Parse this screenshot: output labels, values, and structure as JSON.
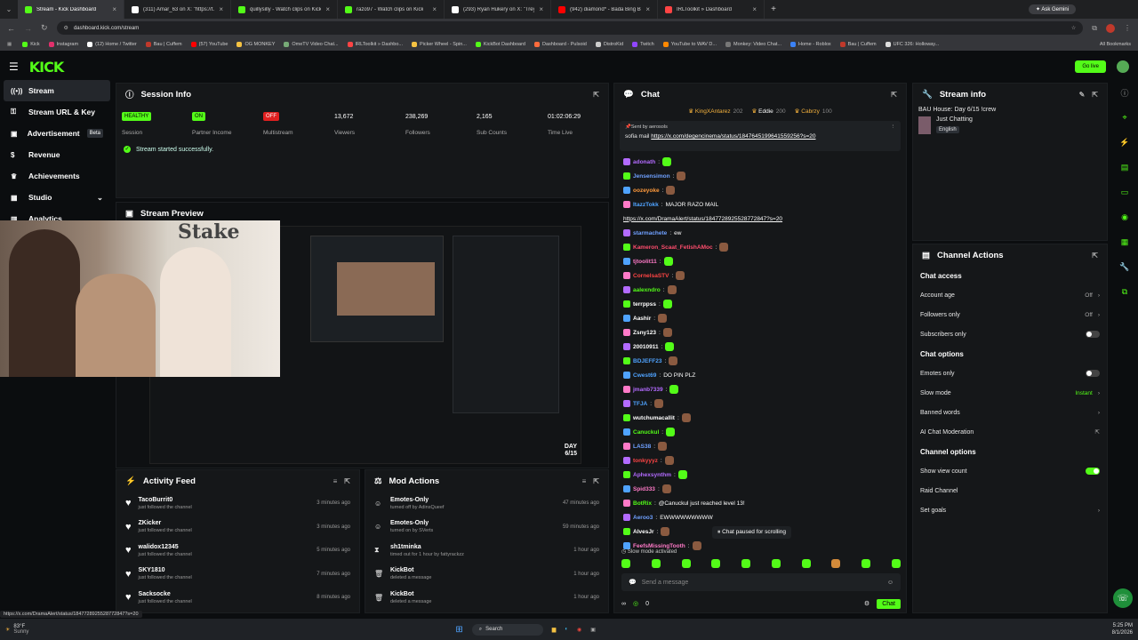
{
  "browser": {
    "tabs": [
      {
        "title": "Stream - Kick Dashboard",
        "color": "#53fc18",
        "active": true
      },
      {
        "title": "(311) Amar_63 on X: \"https://t.c",
        "color": "#ffffff"
      },
      {
        "title": "quillysilly - Watch clips on Kick",
        "color": "#53fc18"
      },
      {
        "title": "razo97 - Watch clips on Kick",
        "color": "#53fc18"
      },
      {
        "title": "(293) Ryan Hukery on X: \"Treyd",
        "color": "#ffffff"
      },
      {
        "title": "(942) diamond* - Bada Bing Ba",
        "color": "#ff0000"
      },
      {
        "title": "IRLToolkit » Dashboard",
        "color": "#ff4444"
      }
    ],
    "ask_gemini": "Ask Gemini",
    "url": "dashboard.kick.com/stream",
    "bookmarks": [
      "Kick",
      "Instagram",
      "(12) Home / Twitter",
      "Bau | Cuffem",
      "(57) YouTube",
      "OG MONKEY",
      "OmeTV Video Chat...",
      "IRLToolkit » Dashbo...",
      "Picker Wheel - Spin...",
      "KickBot Dashboard",
      "Dashboard - Pulsoid",
      "DistroKid",
      "Twitch",
      "YouTube to WAV D...",
      "Monkey: Video Chat...",
      "Home - Roblox",
      "Bau | Cuffem",
      "UFC 326: Holloway..."
    ],
    "all_bookmarks": "All Bookmarks"
  },
  "header": {
    "logo": "KICK",
    "go_live": "Go live"
  },
  "sidebar": {
    "items": [
      {
        "label": "Stream",
        "icon": "broadcast-icon",
        "glyph": "((•))"
      },
      {
        "label": "Stream URL & Key",
        "icon": "link-icon",
        "glyph": "⚿"
      },
      {
        "label": "Advertisement",
        "icon": "megaphone-icon",
        "glyph": "▣",
        "badge": "Beta"
      },
      {
        "label": "Revenue",
        "icon": "dollar-icon",
        "glyph": "$"
      },
      {
        "label": "Achievements",
        "icon": "trophy-icon",
        "glyph": "♛"
      },
      {
        "label": "Studio",
        "icon": "studio-icon",
        "glyph": "▦",
        "chevron": "⌄"
      },
      {
        "label": "Analytics",
        "icon": "chart-icon",
        "glyph": "▥"
      }
    ]
  },
  "session": {
    "title": "Session Info",
    "stats": [
      {
        "value": "HEALTHY",
        "label": "Session",
        "badge_color": "#53fc18"
      },
      {
        "value": "ON",
        "label": "Partner Income",
        "badge_color": "#53fc18"
      },
      {
        "value": "OFF",
        "label": "Multistream",
        "badge_color": "#e02020"
      },
      {
        "value": "13,672",
        "label": "Viewers"
      },
      {
        "value": "238,269",
        "label": "Followers"
      },
      {
        "value": "2,165",
        "label": "Sub Counts"
      },
      {
        "value": "01:02:06:29",
        "label": "Time Live"
      }
    ],
    "success": "Stream started successfully."
  },
  "preview": {
    "title": "Stream Preview",
    "day_label": "DAY",
    "day_value": "6/15"
  },
  "activity": {
    "title": "Activity Feed",
    "items": [
      {
        "name": "TacoBurrit0",
        "sub": "just followed the channel",
        "time": "3 minutes ago"
      },
      {
        "name": "ZKicker",
        "sub": "just followed the channel",
        "time": "3 minutes ago"
      },
      {
        "name": "walidox12345",
        "sub": "just followed the channel",
        "time": "5 minutes ago"
      },
      {
        "name": "SKY1810",
        "sub": "just followed the channel",
        "time": "7 minutes ago"
      },
      {
        "name": "Sacksocke",
        "sub": "just followed the channel",
        "time": "8 minutes ago"
      }
    ]
  },
  "mod": {
    "title": "Mod Actions",
    "items": [
      {
        "name": "Emotes-Only",
        "sub": "turned off by AdinsQueef",
        "time": "47 minutes ago",
        "icon": "smile-icon",
        "glyph": "☺"
      },
      {
        "name": "Emotes-Only",
        "sub": "turned on by SVerts",
        "time": "59 minutes ago",
        "icon": "smile-icon",
        "glyph": "☺"
      },
      {
        "name": "sh1tminka",
        "sub": "timed out for 1 hour by fattyrackzz",
        "time": "1 hour ago",
        "icon": "hourglass-icon",
        "glyph": "⧗"
      },
      {
        "name": "KickBot",
        "sub": "deleted a message",
        "time": "1 hour ago",
        "icon": "trash-icon",
        "glyph": "🗑"
      },
      {
        "name": "KickBot",
        "sub": "deleted a message",
        "time": "1 hour ago",
        "icon": "trash-icon",
        "glyph": "🗑"
      }
    ]
  },
  "chat": {
    "title": "Chat",
    "top_gifters": [
      {
        "name": "KingXAntarez",
        "count": "202"
      },
      {
        "name": "Eddie",
        "count": "200"
      },
      {
        "name": "Cabrzy",
        "count": "100"
      }
    ],
    "pinned_by": "Sent by aerosols",
    "pinned_user": "sofia mail",
    "pinned_link": "https://x.com/degencinema/status/1847645199641559256?s=20",
    "messages": [
      {
        "user": "adonath",
        "color": "#b36bff",
        "text": "",
        "emote": true
      },
      {
        "user": "Jensensimon",
        "color": "#6fa0ff",
        "text": "",
        "emote": true
      },
      {
        "user": "oozeyoke",
        "color": "#ff9a3c",
        "text": "",
        "emote": true
      },
      {
        "user": "ItazzTokk",
        "color": "#4fa3ff",
        "text": "MAJOR RAZO MAIL",
        "link": "https://x.com/DramaAlert/status/1847728925528772847?s=20"
      },
      {
        "user": "starmachete",
        "color": "#6fa0ff",
        "text": "ew"
      },
      {
        "user": "Kameron_Scaat_FetishAMoc",
        "color": "#ff4d6d",
        "text": "",
        "emote": true
      },
      {
        "user": "tjtoolit11",
        "color": "#ff7ac8",
        "text": "",
        "emote": true
      },
      {
        "user": "CornelsaSTV",
        "color": "#ff4444",
        "text": "",
        "emote": true
      },
      {
        "user": "aalexndro",
        "color": "#53fc18",
        "text": "",
        "emote": true
      },
      {
        "user": "terrppss",
        "color": "#ffffff",
        "text": "",
        "emote": true
      },
      {
        "user": "Aashir",
        "color": "#ffffff",
        "text": "",
        "emote": true
      },
      {
        "user": "Zsny123",
        "color": "#ffffff",
        "text": "",
        "emote": true
      },
      {
        "user": "20010911",
        "color": "#ffffff",
        "text": "",
        "emote": true
      },
      {
        "user": "BDJEFF23",
        "color": "#4fa3ff",
        "text": "",
        "emote": true
      },
      {
        "user": "Cwest69",
        "color": "#4fa3ff",
        "text": "DO PIN PLZ"
      },
      {
        "user": "jmanb7339",
        "color": "#b36bff",
        "text": "",
        "emote": true
      },
      {
        "user": "TFJA",
        "color": "#4fa3ff",
        "text": "",
        "emote": true
      },
      {
        "user": "wutchumacallit",
        "color": "#ffffff",
        "text": "",
        "emote": true
      },
      {
        "user": "Canuckul",
        "color": "#53fc18",
        "text": "",
        "emote": true
      },
      {
        "user": "LAS38",
        "color": "#6fa0ff",
        "text": "",
        "emote": true
      },
      {
        "user": "tonkyyyz",
        "color": "#ff4444",
        "text": "",
        "emote": true
      },
      {
        "user": "Aphexsynthm",
        "color": "#b36bff",
        "text": "",
        "emote": true
      },
      {
        "user": "Spid333",
        "color": "#ff7ac8",
        "text": "",
        "emote": true
      },
      {
        "user": "BotRix",
        "color": "#53fc18",
        "text": "@Canuckul just reached level 13!"
      },
      {
        "user": "Aeroo3",
        "color": "#6fa0ff",
        "text": "EWWWWWWWWW"
      },
      {
        "user": "AlvesJr",
        "color": "#ffffff",
        "text": "",
        "emote": true
      },
      {
        "user": "FeefsMissingTooth",
        "color": "#ff7ac8",
        "text": "",
        "emote": true
      }
    ],
    "paused": "Chat paused for scrolling",
    "slow_mode": "Slow mode activated",
    "placeholder": "Send a message",
    "points": "0",
    "send": "Chat"
  },
  "stream_info": {
    "title": "Stream info",
    "stream_title": "BAU House: Day 6/15 !crew",
    "category": "Just Chatting",
    "language": "English"
  },
  "channel_actions": {
    "title": "Channel Actions",
    "chat_access": "Chat access",
    "account_age": {
      "label": "Account age",
      "value": "Off"
    },
    "followers_only": {
      "label": "Followers only",
      "value": "Off"
    },
    "subscribers_only": {
      "label": "Subscribers only",
      "on": false
    },
    "chat_options": "Chat options",
    "emotes_only": {
      "label": "Emotes only",
      "on": false
    },
    "slow_mode": {
      "label": "Slow mode",
      "value": "Instant"
    },
    "banned_words": "Banned words",
    "ai_moderation": "AI Chat Moderation",
    "channel_options": "Channel options",
    "show_view_count": {
      "label": "Show view count",
      "on": true
    },
    "raid_channel": "Raid Channel",
    "set_goals": "Set goals"
  },
  "status_link": "https://x.com/DramaAlert/status/1847728925528772847?s=20",
  "taskbar": {
    "weather_temp": "83°F",
    "weather_desc": "Sunny",
    "search": "Search",
    "time": "5:25 PM",
    "date": "8/1/2026"
  }
}
